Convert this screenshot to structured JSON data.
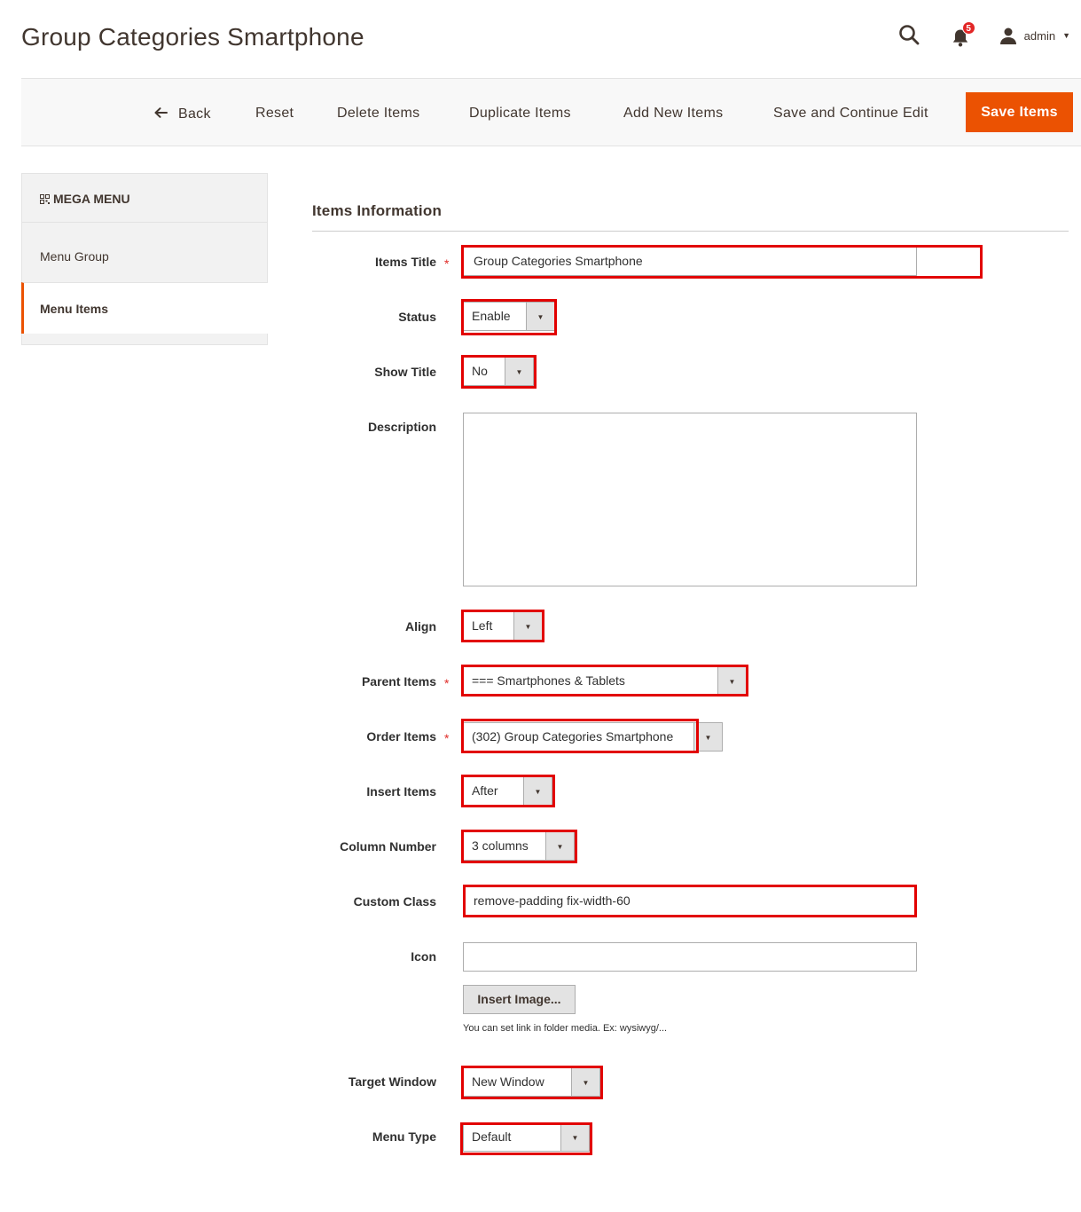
{
  "page": {
    "title": "Group Categories Smartphone"
  },
  "header": {
    "notifications_count": "5",
    "user_name": "admin",
    "icons": [
      "search-icon",
      "bell-icon",
      "user-icon",
      "chevron-down-icon"
    ]
  },
  "actions": {
    "back": "Back",
    "reset": "Reset",
    "delete": "Delete Items",
    "duplicate": "Duplicate Items",
    "add_new": "Add New Items",
    "save_continue": "Save and Continue Edit",
    "save": "Save Items"
  },
  "sidebar": {
    "heading": "MEGA MENU",
    "items": [
      {
        "label": "Menu Group",
        "active": false
      },
      {
        "label": "Menu Items",
        "active": true
      }
    ]
  },
  "form": {
    "section_title": "Items Information",
    "items_title": {
      "label": "Items Title",
      "value": "Group Categories Smartphone",
      "required": true
    },
    "status": {
      "label": "Status",
      "value": "Enable"
    },
    "show_title": {
      "label": "Show Title",
      "value": "No"
    },
    "description": {
      "label": "Description",
      "value": ""
    },
    "align": {
      "label": "Align",
      "value": "Left"
    },
    "parent_items": {
      "label": "Parent Items",
      "value": "=== Smartphones & Tablets",
      "required": true
    },
    "order_items": {
      "label": "Order Items",
      "value": "(302) Group Categories Smartphone",
      "required": true
    },
    "insert_items": {
      "label": "Insert Items",
      "value": "After"
    },
    "column_number": {
      "label": "Column Number",
      "value": "3 columns"
    },
    "custom_class": {
      "label": "Custom Class",
      "value": "remove-padding fix-width-60"
    },
    "icon": {
      "label": "Icon",
      "value": "",
      "button": "Insert Image...",
      "note": "You can set link in folder media. Ex: wysiwyg/..."
    },
    "target_window": {
      "label": "Target Window",
      "value": "New Window"
    },
    "menu_type": {
      "label": "Menu Type",
      "value": "Default"
    },
    "required_mark": "*"
  },
  "colors": {
    "accent": "#eb5202",
    "highlight": "#e20000",
    "required": "#e02b27",
    "badge": "#e22626"
  }
}
